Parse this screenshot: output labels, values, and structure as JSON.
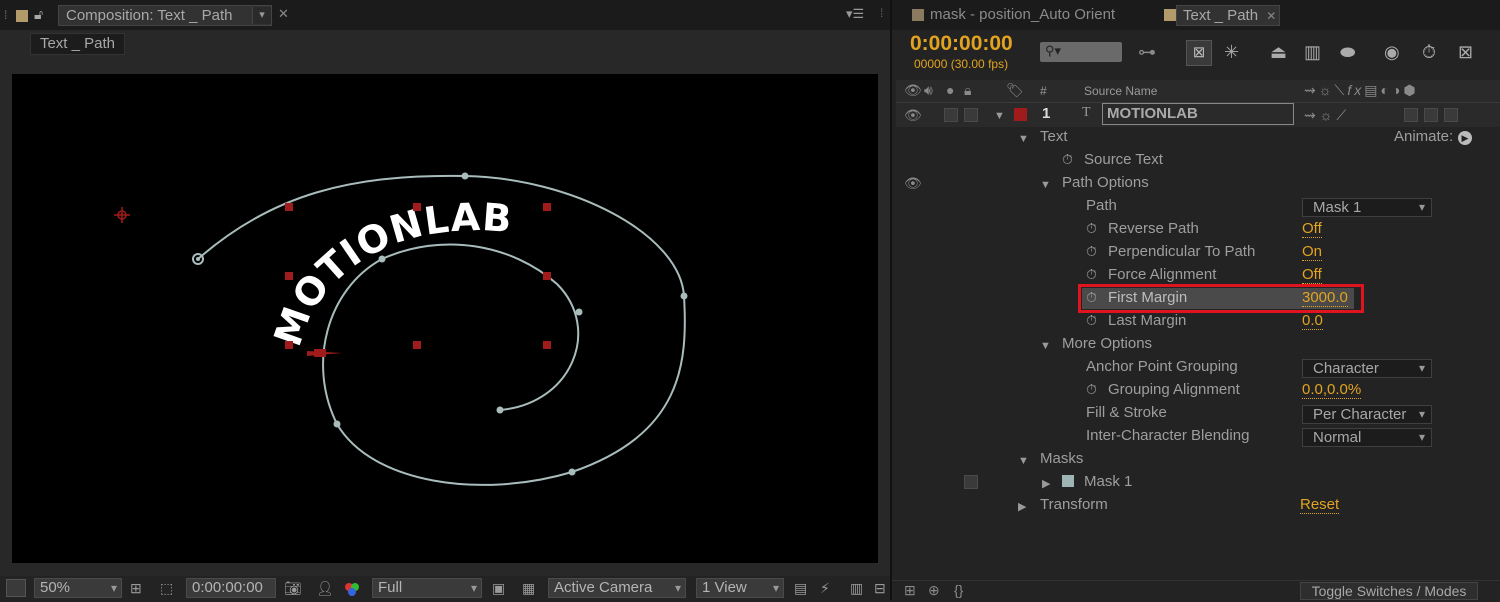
{
  "left_panel": {
    "tab_title": "Composition: Text _ Path",
    "subtab": "Text _ Path",
    "viewer": {
      "text_on_path": "MOTIONLAB"
    },
    "bottom": {
      "zoom": "50%",
      "timecode": "0:00:00:00",
      "resolution": "Full",
      "camera": "Active Camera",
      "views": "1 View"
    }
  },
  "right_panel": {
    "tabs": [
      {
        "label": "mask - position_Auto Orient"
      },
      {
        "label": "Text _ Path"
      }
    ],
    "timecode": "0:00:00:00",
    "fps": "00000 (30.00 fps)",
    "columns": {
      "number": "#",
      "source_name": "Source Name"
    },
    "layer": {
      "index": "1",
      "name": "MOTIONLAB"
    },
    "animate_label": "Animate:",
    "properties": [
      {
        "label": "Text"
      },
      {
        "label": "Source Text"
      },
      {
        "label": "Path Options"
      },
      {
        "label": "Path",
        "value": "Mask 1"
      },
      {
        "label": "Reverse Path",
        "value": "Off"
      },
      {
        "label": "Perpendicular To Path",
        "value": "On"
      },
      {
        "label": "Force Alignment",
        "value": "Off"
      },
      {
        "label": "First Margin",
        "value": "3000.0"
      },
      {
        "label": "Last Margin",
        "value": "0.0"
      },
      {
        "label": "More Options"
      },
      {
        "label": "Anchor Point Grouping",
        "value": "Character"
      },
      {
        "label": "Grouping Alignment",
        "value": "0.0,0.0%"
      },
      {
        "label": "Fill & Stroke",
        "value": "Per Character"
      },
      {
        "label": "Inter-Character Blending",
        "value": "Normal"
      },
      {
        "label": "Masks"
      },
      {
        "label": "Mask 1"
      },
      {
        "label": "Transform",
        "value": "Reset"
      }
    ],
    "footer_button": "Toggle Switches / Modes"
  },
  "colors": {
    "timecode": "#e2a420",
    "highlight_box": "#e0141e",
    "path_stroke": "#a9bcbc",
    "label_red": "#a01c1c"
  },
  "icons": [
    "lock-icon",
    "panel-menu-icon",
    "close-icon",
    "search-icon",
    "eye-icon",
    "audio-icon",
    "solo-icon",
    "label-icon",
    "stopwatch-icon",
    "camera-icon",
    "grid-icon",
    "expand-triangle-icon"
  ]
}
